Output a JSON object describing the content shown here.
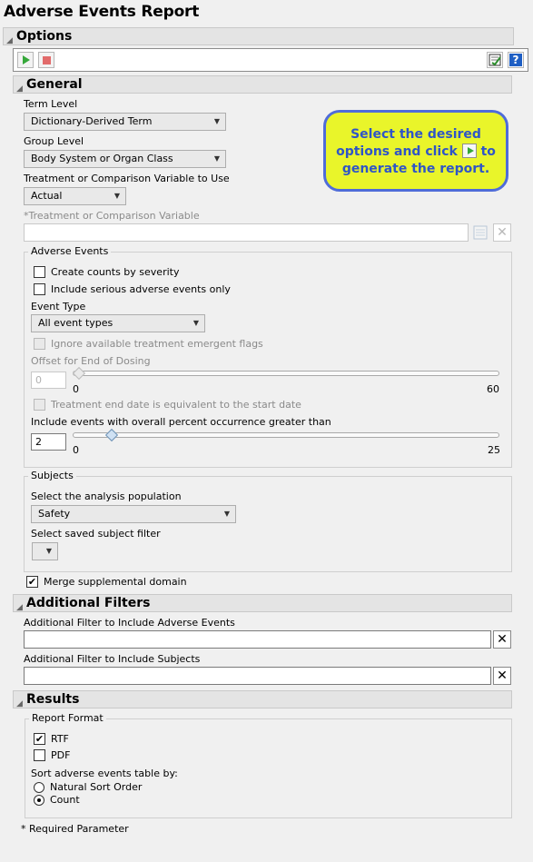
{
  "title": "Adverse Events Report",
  "sections": {
    "options": "Options",
    "general": "General",
    "additional_filters": "Additional Filters",
    "results": "Results"
  },
  "general": {
    "term_level_label": "Term Level",
    "term_level_value": "Dictionary-Derived Term",
    "group_level_label": "Group Level",
    "group_level_value": "Body System or Organ Class",
    "treatment_var_label": "Treatment or Comparison Variable to Use",
    "treatment_var_value": "Actual",
    "treatment_comparison_label": "*Treatment or Comparison Variable",
    "treatment_comparison_value": ""
  },
  "callout": {
    "line1": "Select the desired",
    "line2a": "options and click",
    "line2b": "to",
    "line3": "generate the report."
  },
  "adverse_events": {
    "group_title": "Adverse Events",
    "counts_by_severity": "Create counts by severity",
    "counts_by_severity_checked": false,
    "serious_only": "Include serious adverse events only",
    "serious_only_checked": false,
    "event_type_label": "Event Type",
    "event_type_value": "All event types",
    "ignore_flags": "Ignore available treatment emergent flags",
    "offset_label": "Offset for End of Dosing",
    "offset_value": "0",
    "offset_min": "0",
    "offset_max": "60",
    "offset_fraction": 0,
    "end_date_equiv": "Treatment end date is equivalent to the start date",
    "pct_label": "Include events with overall percent occurrence greater than",
    "pct_value": "2",
    "pct_min": "0",
    "pct_max": "25",
    "pct_fraction": 0.08
  },
  "subjects": {
    "group_title": "Subjects",
    "population_label": "Select the analysis population",
    "population_value": "Safety",
    "saved_filter_label": "Select saved subject filter",
    "saved_filter_value": ""
  },
  "merge_supplemental": "Merge supplemental domain",
  "merge_supplemental_checked": true,
  "filters": {
    "include_ae_label": "Additional Filter to Include Adverse Events",
    "include_ae_value": "",
    "include_subjects_label": "Additional Filter to Include Subjects",
    "include_subjects_value": ""
  },
  "results": {
    "report_format_title": "Report Format",
    "rtf": "RTF",
    "rtf_checked": true,
    "pdf": "PDF",
    "pdf_checked": false,
    "sort_label": "Sort adverse events table by:",
    "sort_natural": "Natural Sort Order",
    "sort_count": "Count",
    "sort_selected": "Count"
  },
  "required_note": "* Required Parameter",
  "icons": {
    "run": "play-icon",
    "stop": "stop-icon",
    "save_settings": "save-settings-icon",
    "help": "help-icon",
    "collapse": "collapse-triangle-icon",
    "remove": "close-icon",
    "add": "add-column-icon",
    "dropdown": "chevron-down-icon"
  },
  "colors": {
    "callout_bg": "#e9f52a",
    "callout_border": "#4f6cd9",
    "callout_text": "#2f55c7",
    "run_green": "#36a83a",
    "stop_red": "#e26b6b"
  }
}
